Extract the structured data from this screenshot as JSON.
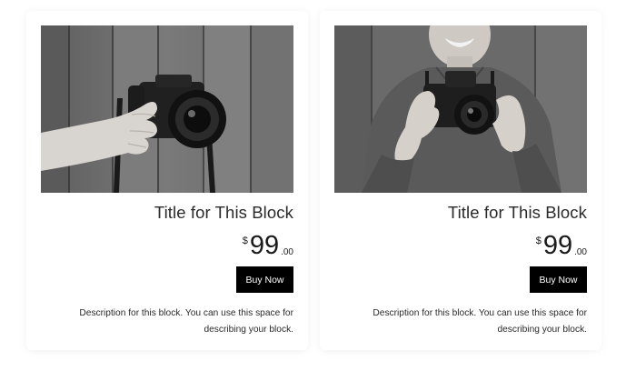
{
  "cards": [
    {
      "image_alt": "hand holding camera",
      "title": "Title for This Block",
      "price": {
        "currency": "$",
        "whole": "99",
        "cents": ".00"
      },
      "button_label": "Buy Now",
      "description": "Description for this block. You can use this space for describing your block."
    },
    {
      "image_alt": "man holding camera",
      "title": "Title for This Block",
      "price": {
        "currency": "$",
        "whole": "99",
        "cents": ".00"
      },
      "button_label": "Buy Now",
      "description": "Description for this block. You can use this space for describing your block."
    }
  ]
}
